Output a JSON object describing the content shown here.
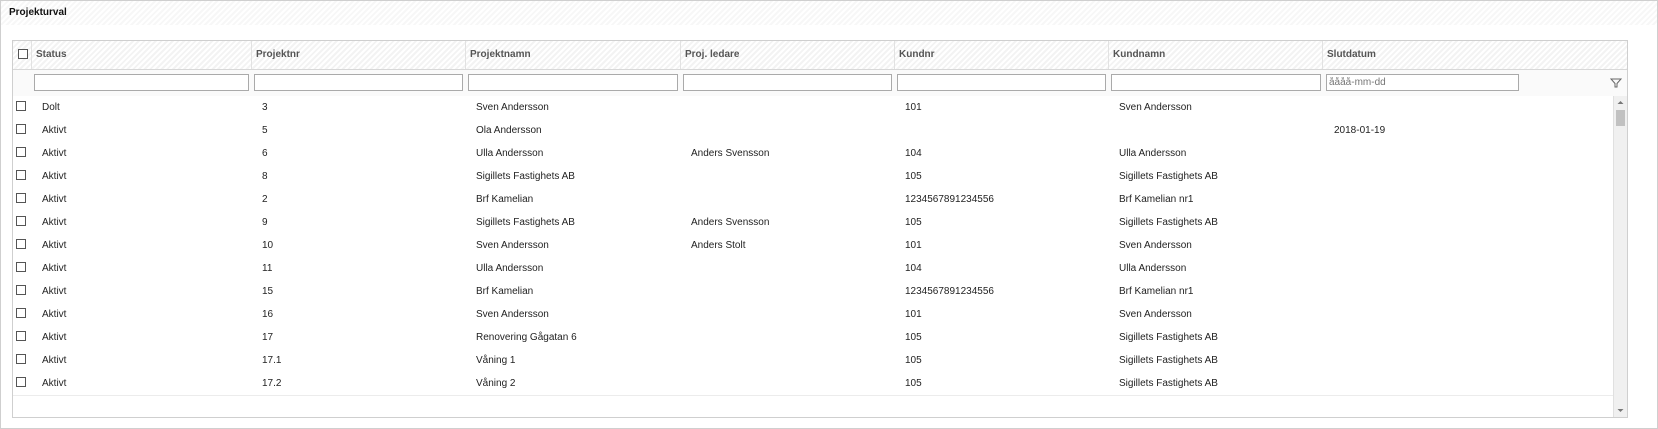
{
  "panel": {
    "title": "Projekturval"
  },
  "columns": [
    {
      "key": "status",
      "label": "Status"
    },
    {
      "key": "projektnr",
      "label": "Projektnr"
    },
    {
      "key": "projektnamn",
      "label": "Projektnamn"
    },
    {
      "key": "projledare",
      "label": "Proj. ledare"
    },
    {
      "key": "kundnr",
      "label": "Kundnr"
    },
    {
      "key": "kundnamn",
      "label": "Kundnamn"
    },
    {
      "key": "slutdatum",
      "label": "Slutdatum"
    }
  ],
  "filters": {
    "status": "",
    "projektnr": "",
    "projektnamn": "",
    "projledare": "",
    "kundnr": "",
    "kundnamn": "",
    "slutdatum": "",
    "slutdatum_placeholder": "åååå-mm-dd"
  },
  "icons": {
    "filter": "funnel-icon",
    "scroll_up": "chevron-up-icon",
    "scroll_down": "chevron-down-icon"
  },
  "rows": [
    {
      "status": "Dolt",
      "projektnr": "3",
      "projektnamn": "Sven Andersson",
      "projledare": "",
      "kundnr": "101",
      "kundnamn": "Sven Andersson",
      "slutdatum": ""
    },
    {
      "status": "Aktivt",
      "projektnr": "5",
      "projektnamn": "Ola Andersson",
      "projledare": "",
      "kundnr": "",
      "kundnamn": "",
      "slutdatum": "2018-01-19"
    },
    {
      "status": "Aktivt",
      "projektnr": "6",
      "projektnamn": "Ulla Andersson",
      "projledare": "Anders Svensson",
      "kundnr": "104",
      "kundnamn": "Ulla Andersson",
      "slutdatum": ""
    },
    {
      "status": "Aktivt",
      "projektnr": "8",
      "projektnamn": "Sigillets Fastighets AB",
      "projledare": "",
      "kundnr": "105",
      "kundnamn": "Sigillets Fastighets AB",
      "slutdatum": ""
    },
    {
      "status": "Aktivt",
      "projektnr": "2",
      "projektnamn": "Brf Kamelian",
      "projledare": "",
      "kundnr": "1234567891234556",
      "kundnamn": "Brf Kamelian nr1",
      "slutdatum": ""
    },
    {
      "status": "Aktivt",
      "projektnr": "9",
      "projektnamn": "Sigillets Fastighets AB",
      "projledare": "Anders Svensson",
      "kundnr": "105",
      "kundnamn": "Sigillets Fastighets AB",
      "slutdatum": ""
    },
    {
      "status": "Aktivt",
      "projektnr": "10",
      "projektnamn": "Sven Andersson",
      "projledare": "Anders Stolt",
      "kundnr": "101",
      "kundnamn": "Sven Andersson",
      "slutdatum": ""
    },
    {
      "status": "Aktivt",
      "projektnr": "11",
      "projektnamn": "Ulla Andersson",
      "projledare": "",
      "kundnr": "104",
      "kundnamn": "Ulla Andersson",
      "slutdatum": ""
    },
    {
      "status": "Aktivt",
      "projektnr": "15",
      "projektnamn": "Brf Kamelian",
      "projledare": "",
      "kundnr": "1234567891234556",
      "kundnamn": "Brf Kamelian nr1",
      "slutdatum": ""
    },
    {
      "status": "Aktivt",
      "projektnr": "16",
      "projektnamn": "Sven Andersson",
      "projledare": "",
      "kundnr": "101",
      "kundnamn": "Sven Andersson",
      "slutdatum": ""
    },
    {
      "status": "Aktivt",
      "projektnr": "17",
      "projektnamn": "Renovering Gågatan 6",
      "projledare": "",
      "kundnr": "105",
      "kundnamn": "Sigillets Fastighets AB",
      "slutdatum": ""
    },
    {
      "status": "Aktivt",
      "projektnr": "17.1",
      "projektnamn": "Våning 1",
      "projledare": "",
      "kundnr": "105",
      "kundnamn": "Sigillets Fastighets AB",
      "slutdatum": ""
    },
    {
      "status": "Aktivt",
      "projektnr": "17.2",
      "projektnamn": "Våning 2",
      "projledare": "",
      "kundnr": "105",
      "kundnamn": "Sigillets Fastighets AB",
      "slutdatum": ""
    }
  ]
}
